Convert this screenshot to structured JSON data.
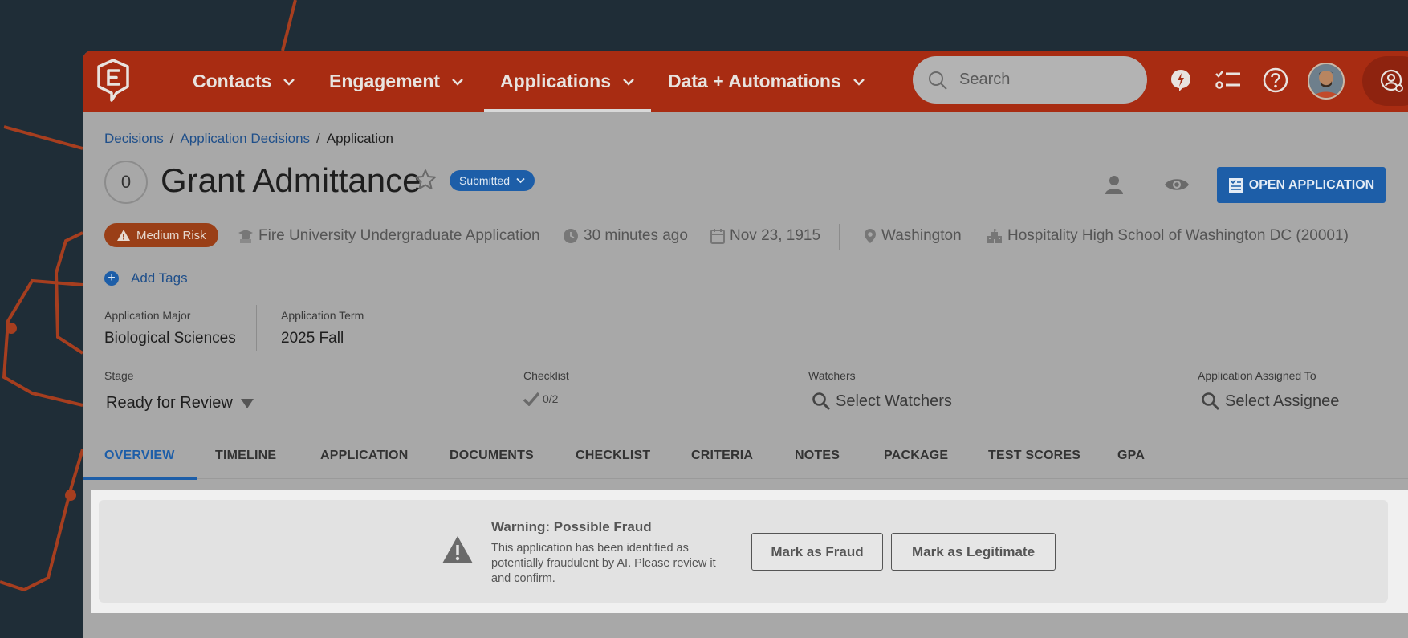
{
  "nav": {
    "items": [
      {
        "label": "Contacts"
      },
      {
        "label": "Engagement"
      },
      {
        "label": "Applications"
      },
      {
        "label": "Data + Automations"
      }
    ],
    "search_placeholder": "Search"
  },
  "breadcrumb": {
    "items": [
      "Decisions",
      "Application Decisions"
    ],
    "current": "Application",
    "separator": "/"
  },
  "header": {
    "count": "0",
    "title": "Grant Admittance",
    "status": "Submitted",
    "open_button": "OPEN APPLICATION"
  },
  "meta": {
    "risk": "Medium Risk",
    "application_type": "Fire University Undergraduate Application",
    "time_ago": "30 minutes ago",
    "date": "Nov 23, 1915",
    "location": "Washington",
    "school": "Hospitality High School of Washington DC (20001)"
  },
  "tags": {
    "add_label": "Add Tags"
  },
  "fields": {
    "major_label": "Application Major",
    "major_value": "Biological Sciences",
    "term_label": "Application Term",
    "term_value": "2025 Fall",
    "stage_label": "Stage",
    "stage_value": "Ready for Review",
    "checklist_label": "Checklist",
    "checklist_value": "0/2",
    "watchers_label": "Watchers",
    "watchers_placeholder": "Select Watchers",
    "assigned_label": "Application Assigned To",
    "assigned_placeholder": "Select Assignee"
  },
  "tabs": [
    "OVERVIEW",
    "TIMELINE",
    "APPLICATION",
    "DOCUMENTS",
    "CHECKLIST",
    "CRITERIA",
    "NOTES",
    "PACKAGE",
    "TEST SCORES",
    "GPA"
  ],
  "banner": {
    "title": "Warning: Possible Fraud",
    "message": "This application has been identified as potentially fraudulent by AI. Please review it and confirm.",
    "fraud_button": "Mark as Fraud",
    "legit_button": "Mark as Legitimate"
  },
  "colors": {
    "nav_bg": "#a82c12",
    "accent_blue": "#1d5ea8",
    "risk_bg": "#9a3f17",
    "page_bg": "#1f2d37"
  }
}
